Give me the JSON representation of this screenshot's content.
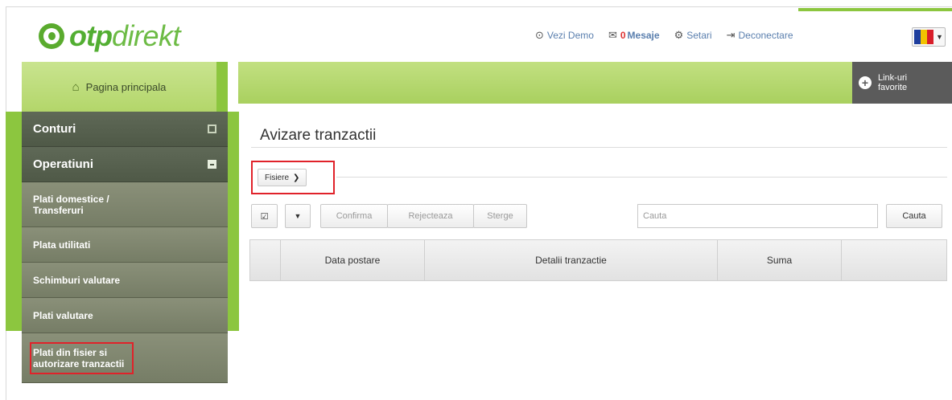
{
  "header": {
    "logo_bold": "otp",
    "logo_light": "direkt",
    "nav": {
      "demo": "Vezi Demo",
      "messages_count": "0",
      "messages_label": "Mesaje",
      "settings": "Setari",
      "logout": "Deconectare"
    },
    "flag_colors": [
      "#1f3f9e",
      "#f2c300",
      "#d81e2a"
    ]
  },
  "sidebar": {
    "home": "Pagina principala",
    "sections": [
      {
        "label": "Conturi",
        "expanded": false
      },
      {
        "label": "Operatiuni",
        "expanded": true
      }
    ],
    "sub_items": [
      {
        "line1": "Plati domestice /",
        "line2": "Transferuri"
      },
      {
        "line1": "Plata utilitati"
      },
      {
        "line1": "Schimburi valutare"
      },
      {
        "line1": "Plati valutare"
      },
      {
        "line1": "Plati din fisier si",
        "line2": "autorizare tranzactii",
        "highlighted": true
      }
    ]
  },
  "favorites": {
    "line1": "Link-uri",
    "line2": "favorite"
  },
  "main": {
    "title": "Avizare tranzactii",
    "files_button": "Fisiere",
    "toolbar": {
      "confirm": "Confirma",
      "reject": "Rejecteaza",
      "delete": "Sterge",
      "search_placeholder": "Cauta",
      "search_button": "Cauta"
    },
    "table": {
      "columns": [
        "",
        "Data postare",
        "Detalii tranzactie",
        "Suma",
        ""
      ]
    }
  },
  "colors": {
    "brand_green": "#8cc63f",
    "highlight_red": "#e0222a",
    "menu_dark": "#4f5947"
  }
}
